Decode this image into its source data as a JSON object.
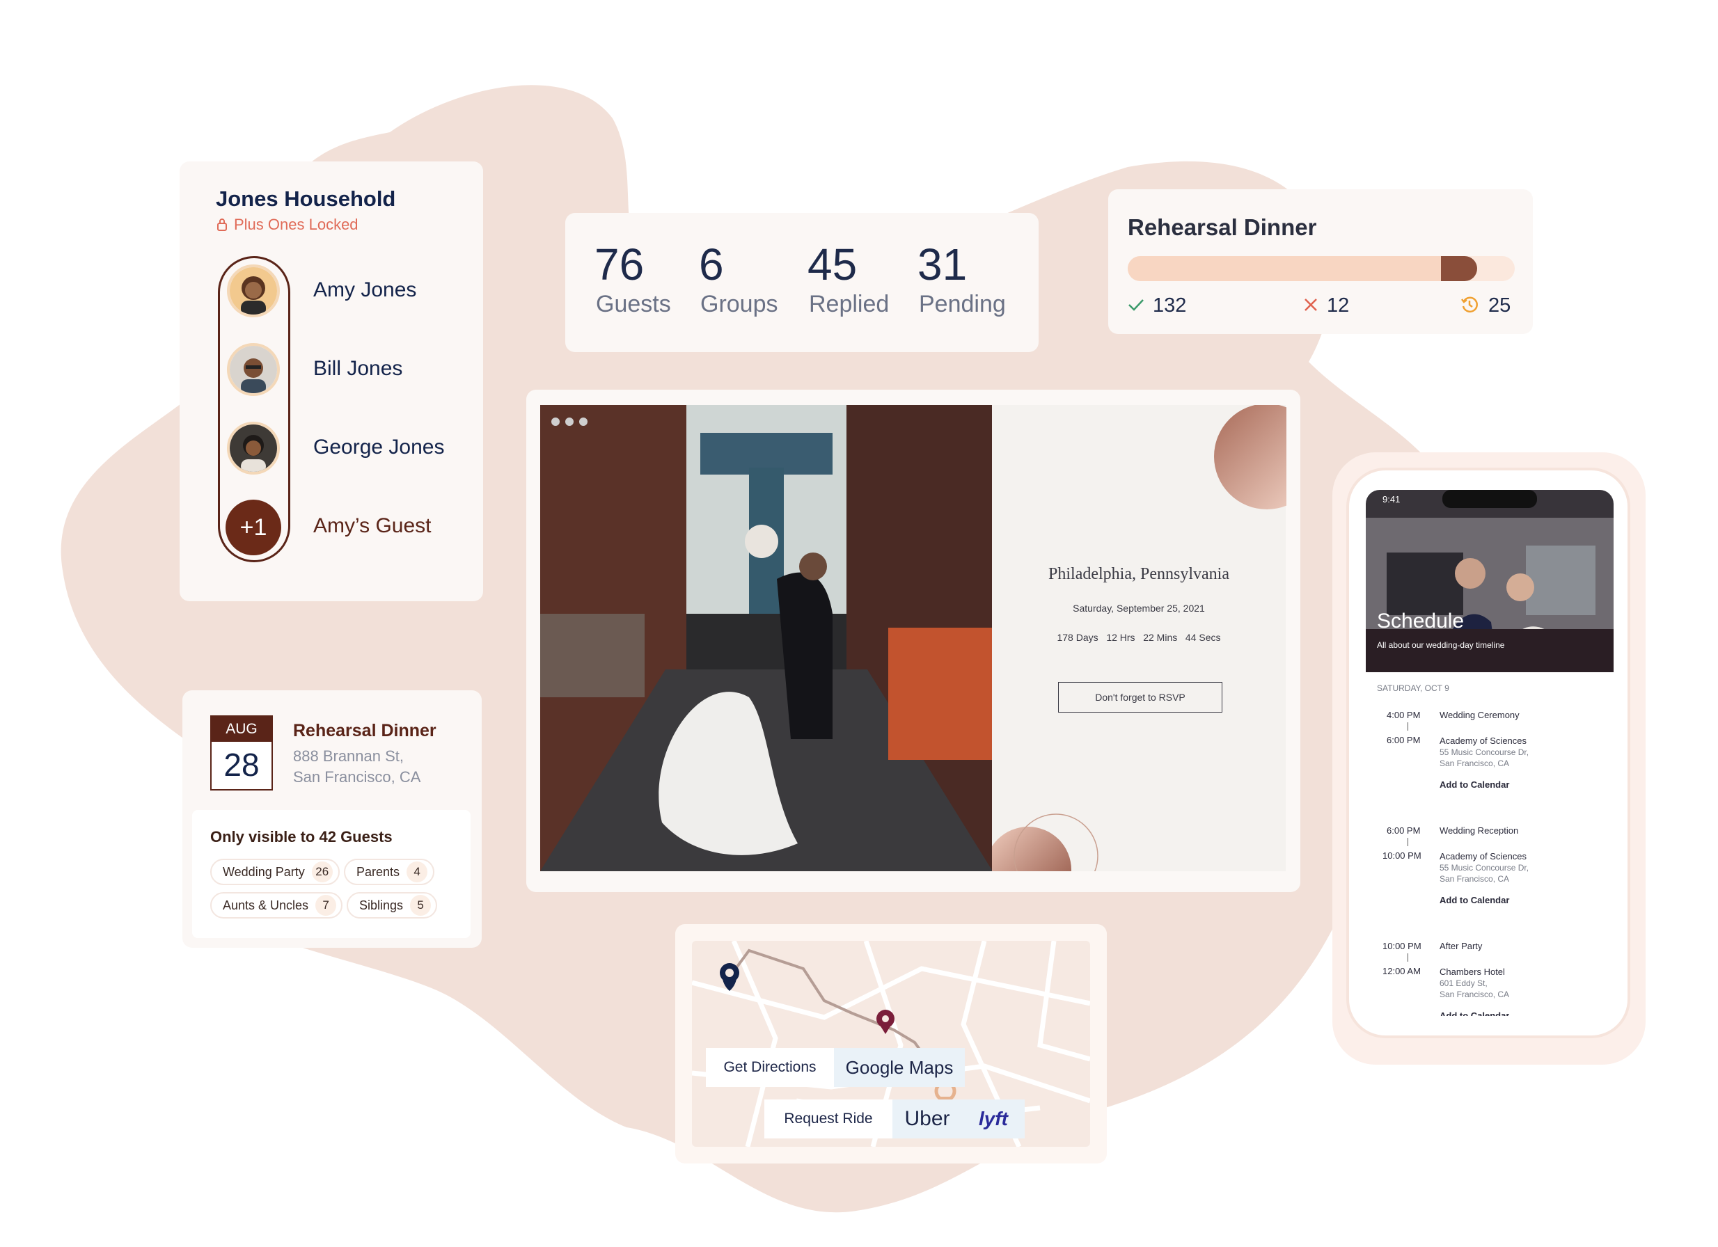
{
  "household": {
    "title": "Jones Household",
    "lock_note": "Plus Ones Locked",
    "members": [
      {
        "name": "Amy Jones",
        "avatar": "person-avatar"
      },
      {
        "name": "Bill Jones",
        "avatar": "person-avatar"
      },
      {
        "name": "George Jones",
        "avatar": "person-avatar"
      },
      {
        "name": "Amy’s Guest",
        "avatar": "+1"
      }
    ]
  },
  "stats": [
    {
      "value": "76",
      "label": "Guests"
    },
    {
      "value": "6",
      "label": "Groups"
    },
    {
      "value": "45",
      "label": "Replied"
    },
    {
      "value": "31",
      "label": "Pending"
    }
  ],
  "rehearsal_summary": {
    "title": "Rehearsal Dinner",
    "progress_fraction": 0.9,
    "accepted": "132",
    "declined": "12",
    "pending": "25",
    "colors": {
      "accepted": "#3a9a6a",
      "declined": "#e0614e",
      "pending": "#f0a030"
    }
  },
  "invite": {
    "location": "Philadelphia, Pennsylvania",
    "date": "Saturday, September 25, 2021",
    "countdown": [
      "178 Days",
      "12 Hrs",
      "22 Mins",
      "44 Secs"
    ],
    "rsvp_button": "Don't forget to RSVP"
  },
  "event_card": {
    "month": "AUG",
    "day": "28",
    "title": "Rehearsal Dinner",
    "address_line1": "888 Brannan St,",
    "address_line2": "San Francisco, CA",
    "visibility": "Only visible to 42 Guests",
    "groups": [
      {
        "name": "Wedding Party",
        "count": "26"
      },
      {
        "name": "Parents",
        "count": "4"
      },
      {
        "name": "Aunts & Uncles",
        "count": "7"
      },
      {
        "name": "Siblings",
        "count": "5"
      }
    ]
  },
  "map": {
    "get_directions": "Get Directions",
    "google_maps": "Google Maps",
    "request_ride": "Request Ride",
    "uber": "Uber",
    "lyft": "lyft"
  },
  "phone": {
    "status_time": "9:41",
    "hero_title": "Schedule",
    "hero_subtitle": "All about our wedding-day timeline",
    "day_label": "SATURDAY, OCT 9",
    "events": [
      {
        "start": "4:00 PM",
        "end": "6:00 PM",
        "name": "Wedding Ceremony",
        "venue": "Academy of Sciences",
        "addr1": "55 Music Concourse Dr,",
        "addr2": "San Francisco, CA",
        "cal": "Add to Calendar"
      },
      {
        "start": "6:00 PM",
        "end": "10:00 PM",
        "name": "Wedding Reception",
        "venue": "Academy of Sciences",
        "addr1": "55 Music Concourse Dr,",
        "addr2": "San Francisco, CA",
        "cal": "Add to Calendar"
      },
      {
        "start": "10:00 PM",
        "end": "12:00 AM",
        "name": "After Party",
        "venue": "Chambers Hotel",
        "addr1": "601 Eddy St,",
        "addr2": "San Francisco, CA",
        "cal": "Add to Calendar"
      }
    ]
  }
}
